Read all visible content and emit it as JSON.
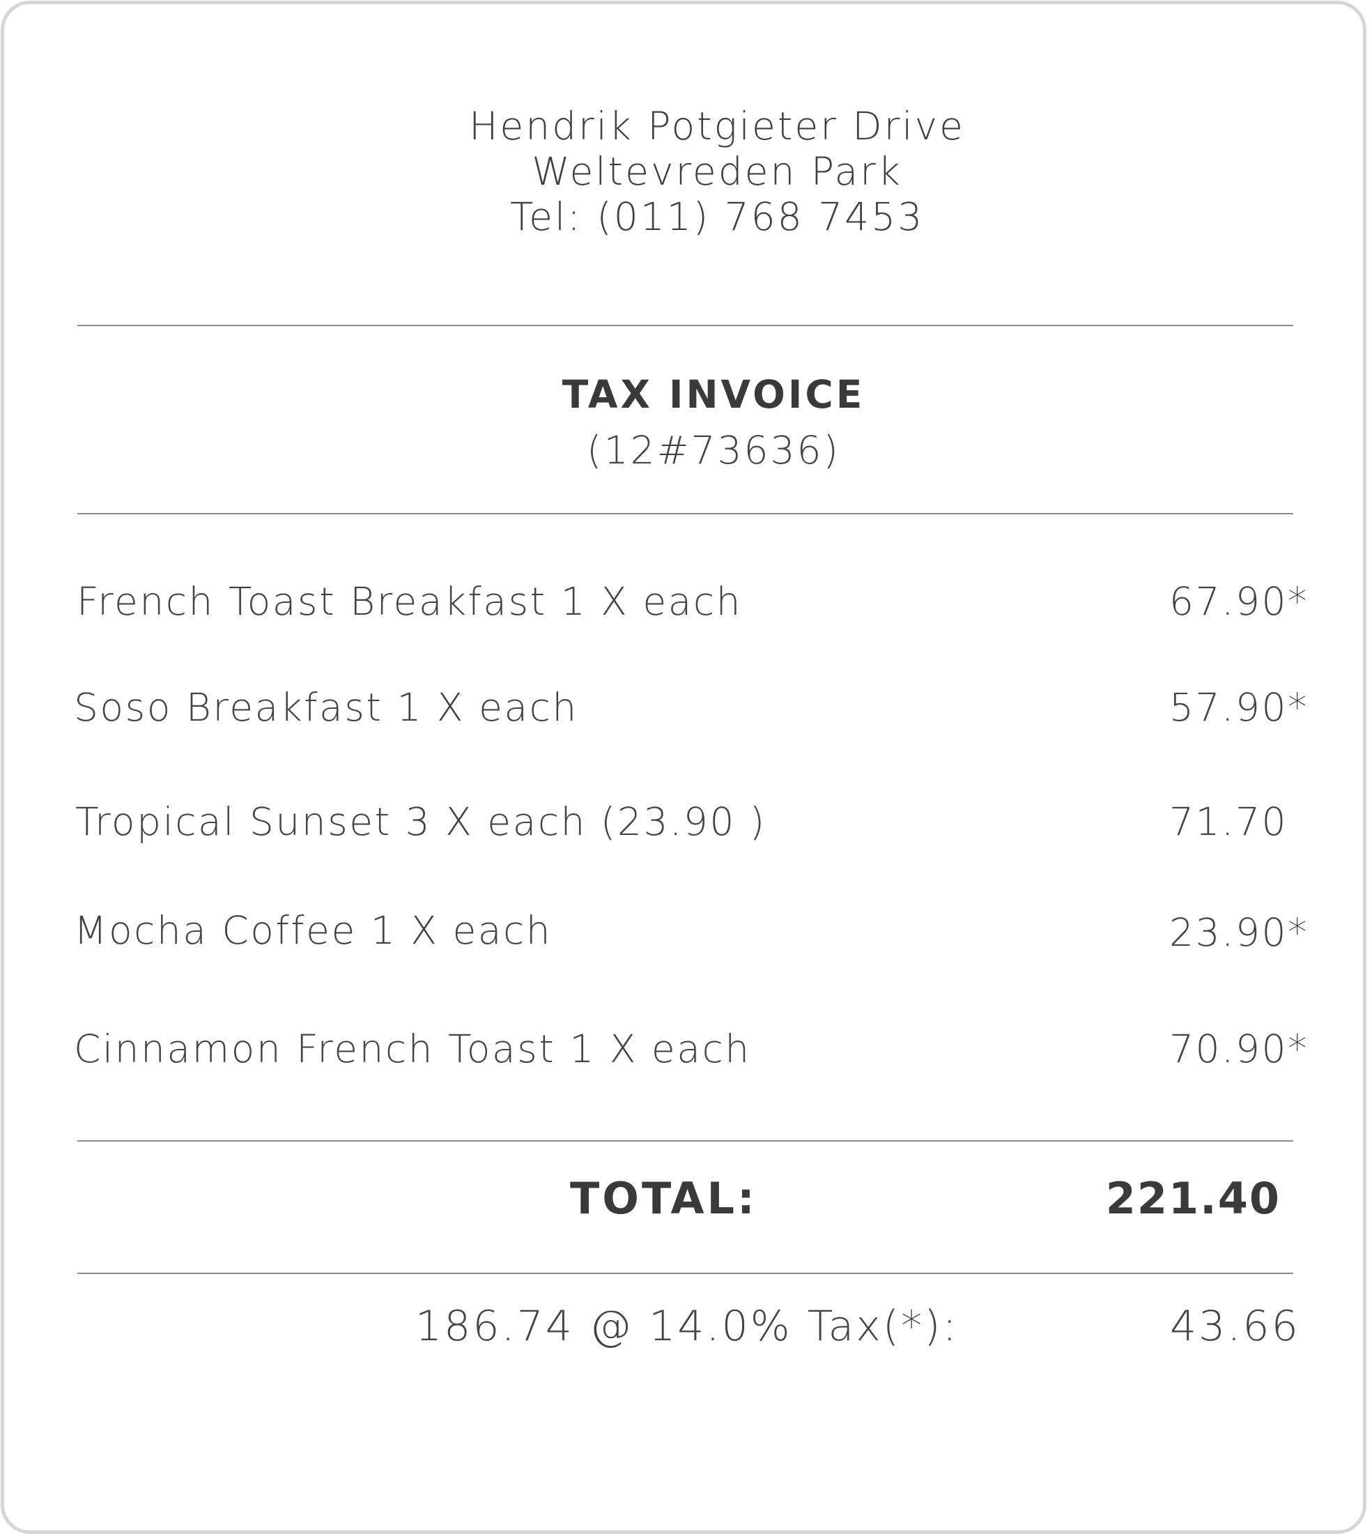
{
  "header": {
    "address_line1": "Hendrik Potgieter Drive",
    "address_line2": "Weltevreden Park",
    "phone": "Tel: (011) 768 7453"
  },
  "invoice": {
    "title": "TAX INVOICE",
    "number": "(12#73636)"
  },
  "items": [
    {
      "description": "French Toast Breakfast 1 X each",
      "amount": "67.90*"
    },
    {
      "description": "Soso Breakfast 1 X each",
      "amount": "57.90*"
    },
    {
      "description": "Tropical Sunset 3 X each (23.90 )",
      "amount": "71.70"
    },
    {
      "description": "Mocha Coffee 1 X each",
      "amount": "23.90*"
    },
    {
      "description": "Cinnamon French Toast 1 X each",
      "amount": "70.90*"
    }
  ],
  "totals": {
    "total_label": "TOTAL:",
    "total_value": "221.40",
    "tax_label": "186.74 @ 14.0% Tax(*):",
    "tax_value": "43.66"
  }
}
